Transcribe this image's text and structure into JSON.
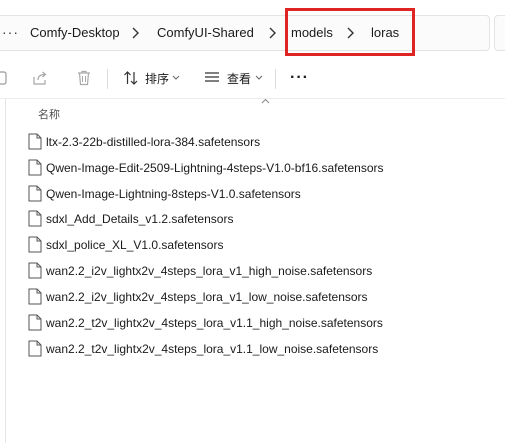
{
  "breadcrumb": {
    "items": [
      "Comfy-Desktop",
      "ComfyUI-Shared",
      "models",
      "loras"
    ]
  },
  "toolbar": {
    "sort_label": "排序",
    "view_label": "查看"
  },
  "list": {
    "column_name": "名称",
    "files": [
      "ltx-2.3-22b-distilled-lora-384.safetensors",
      "Qwen-Image-Edit-2509-Lightning-4steps-V1.0-bf16.safetensors",
      "Qwen-Image-Lightning-8steps-V1.0.safetensors",
      "sdxl_Add_Details_v1.2.safetensors",
      "sdxl_police_XL_V1.0.safetensors",
      "wan2.2_i2v_lightx2v_4steps_lora_v1_high_noise.safetensors",
      "wan2.2_i2v_lightx2v_4steps_lora_v1_low_noise.safetensors",
      "wan2.2_t2v_lightx2v_4steps_lora_v1.1_high_noise.safetensors",
      "wan2.2_t2v_lightx2v_4steps_lora_v1.1_low_noise.safetensors"
    ]
  },
  "colors": {
    "highlight": "#e02424",
    "background": "#ffffff"
  }
}
